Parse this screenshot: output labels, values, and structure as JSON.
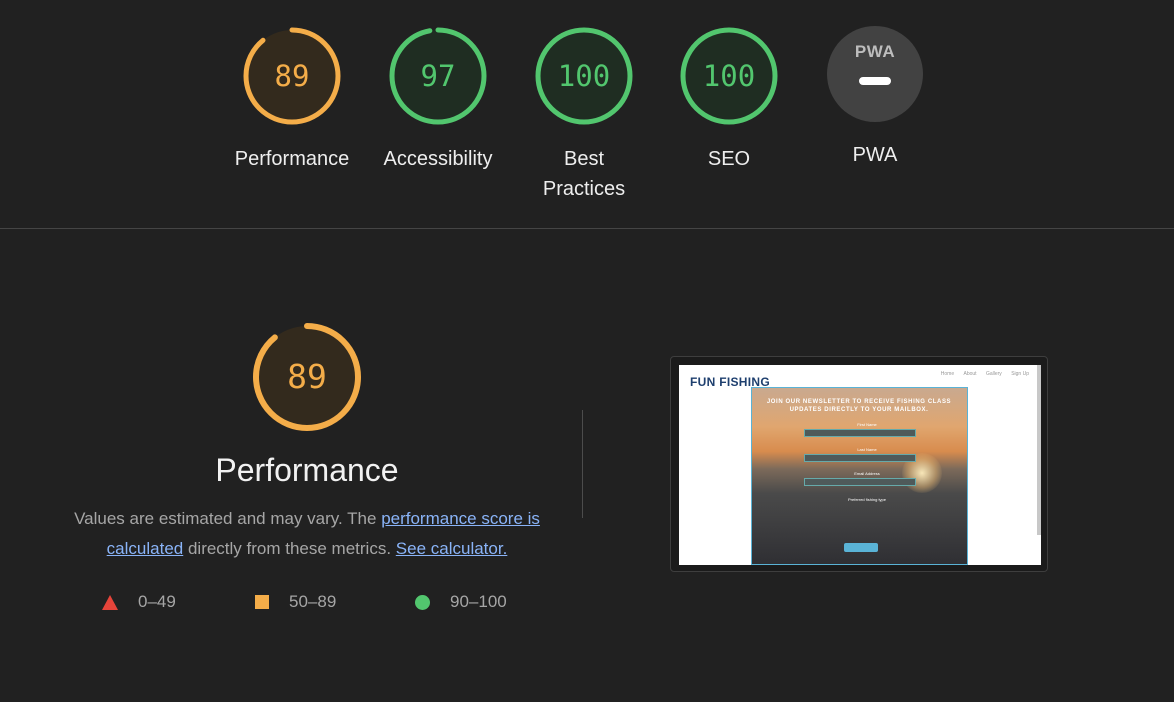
{
  "colors": {
    "pass": "#52c66e",
    "average": "#f4ad49",
    "fail": "#e6443a",
    "background": "#212121"
  },
  "categories": [
    {
      "label": "Performance",
      "score": 89,
      "rating": "average"
    },
    {
      "label": "Accessibility",
      "score": 97,
      "rating": "pass"
    },
    {
      "label": "Best Practices",
      "score": 100,
      "rating": "pass"
    },
    {
      "label": "SEO",
      "score": 100,
      "rating": "pass"
    },
    {
      "label": "PWA",
      "score": null,
      "rating": "na",
      "badge_text": "PWA"
    }
  ],
  "performance": {
    "score": 89,
    "rating": "average",
    "title": "Performance",
    "description_prefix": "Values are estimated and may vary. The ",
    "link_score": "performance score is calculated",
    "description_mid": " directly from these metrics. ",
    "link_calculator": "See calculator."
  },
  "legend": [
    {
      "range": "0–49",
      "shape": "triangle"
    },
    {
      "range": "50–89",
      "shape": "square"
    },
    {
      "range": "90–100",
      "shape": "circle"
    }
  ],
  "screenshot": {
    "logo": "FUN FISHING",
    "nav": [
      "Home",
      "About",
      "Gallery",
      "Sign Up"
    ],
    "headline": "JOIN OUR NEWSLETTER TO RECEIVE FISHING CLASS UPDATES DIRECTLY TO YOUR MAILBOX.",
    "fields": [
      "First Name",
      "Last Name",
      "Email Address"
    ],
    "fishing_type_label": "Preferred fishing type"
  }
}
